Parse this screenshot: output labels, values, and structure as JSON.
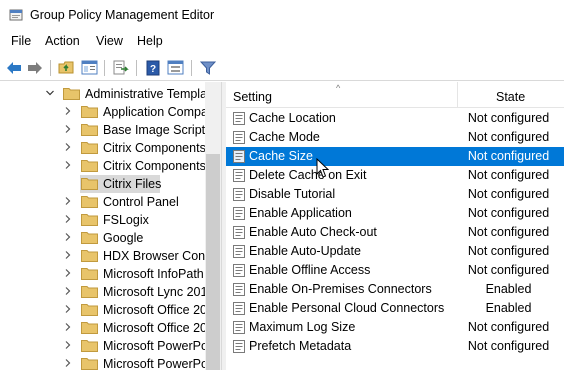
{
  "window": {
    "title": "Group Policy Management Editor",
    "app_icon": "gpo-editor-icon"
  },
  "menu": [
    {
      "label": "File"
    },
    {
      "label": "Action"
    },
    {
      "label": "View"
    },
    {
      "label": "Help"
    }
  ],
  "toolbar": {
    "buttons": [
      "back-arrow-icon",
      "forward-arrow-icon",
      "up-folder-icon",
      "show-hide-tree-icon",
      "export-list-icon",
      "help-icon",
      "properties-icon",
      "filter-icon"
    ]
  },
  "tree": {
    "items": [
      {
        "label": "Administrative Templa",
        "expanded": true
      },
      {
        "label": "Application Compa"
      },
      {
        "label": "Base Image Script F"
      },
      {
        "label": "Citrix Components"
      },
      {
        "label": "Citrix Components"
      },
      {
        "label": "Citrix Files",
        "selected": true
      },
      {
        "label": "Control Panel"
      },
      {
        "label": "FSLogix"
      },
      {
        "label": "Google"
      },
      {
        "label": "HDX Browser Conte"
      },
      {
        "label": "Microsoft InfoPath"
      },
      {
        "label": "Microsoft Lync 201"
      },
      {
        "label": "Microsoft Office 20"
      },
      {
        "label": "Microsoft Office 20"
      },
      {
        "label": "Microsoft PowerPo"
      },
      {
        "label": "Microsoft PowerPo"
      }
    ]
  },
  "list": {
    "columns": {
      "setting": "Setting",
      "state": "State"
    },
    "rows": [
      {
        "name": "Cache Location",
        "state": "Not configured"
      },
      {
        "name": "Cache Mode",
        "state": "Not configured"
      },
      {
        "name": "Cache Size",
        "state": "Not configured",
        "selected": true
      },
      {
        "name": "Delete Cache on Exit",
        "state": "Not configured"
      },
      {
        "name": "Disable Tutorial",
        "state": "Not configured"
      },
      {
        "name": "Enable Application",
        "state": "Not configured"
      },
      {
        "name": "Enable Auto Check-out",
        "state": "Not configured"
      },
      {
        "name": "Enable Auto-Update",
        "state": "Not configured"
      },
      {
        "name": "Enable Offline Access",
        "state": "Not configured"
      },
      {
        "name": "Enable On-Premises Connectors",
        "state": "Enabled"
      },
      {
        "name": "Enable Personal Cloud Connectors",
        "state": "Enabled"
      },
      {
        "name": "Maximum Log Size",
        "state": "Not configured"
      },
      {
        "name": "Prefetch Metadata",
        "state": "Not configured"
      }
    ]
  },
  "colors": {
    "selection": "#0078d7",
    "tree_selection": "#d9d9d9",
    "folder": "#e8c46a"
  }
}
